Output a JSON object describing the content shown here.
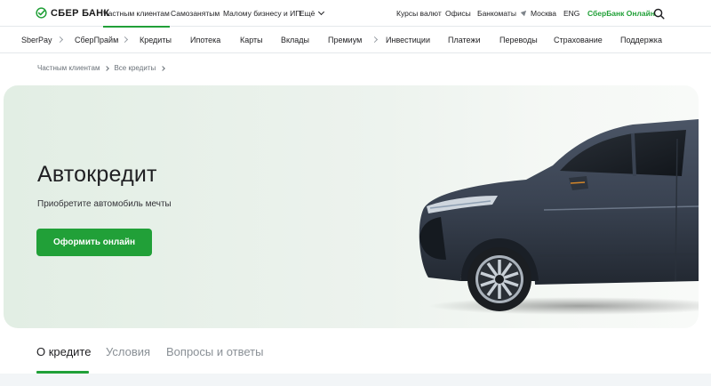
{
  "header": {
    "logo_text": "СБЕР БАНК",
    "segments": [
      "Частным клиентам",
      "Самозанятым",
      "Малому бизнесу и ИП",
      "Ещё"
    ],
    "utility": [
      "Курсы валют",
      "Офисы",
      "Банкоматы",
      "Москва",
      "ENG",
      "СберБанк Онлайн"
    ]
  },
  "nav": [
    "SberPay",
    "СберПрайм",
    "Кредиты",
    "Ипотека",
    "Карты",
    "Вклады",
    "Премиум",
    "Инвестиции",
    "Платежи",
    "Переводы",
    "Страхование",
    "Поддержка"
  ],
  "breadcrumb": [
    "Частным клиентам",
    "Все кредиты"
  ],
  "hero": {
    "title": "Автокредит",
    "subtitle": "Приобретите автомобиль мечты",
    "button": "Оформить онлайн"
  },
  "tabs": [
    "О кредите",
    "Условия",
    "Вопросы и ответы"
  ],
  "colors": {
    "accent": "#21a038",
    "hero_bg": "#e6efe8",
    "car_body": "#3a4352"
  },
  "icons": [
    "sber-logo-icon",
    "chevron-down-icon",
    "location-icon",
    "search-icon",
    "chevron-right-icon"
  ]
}
